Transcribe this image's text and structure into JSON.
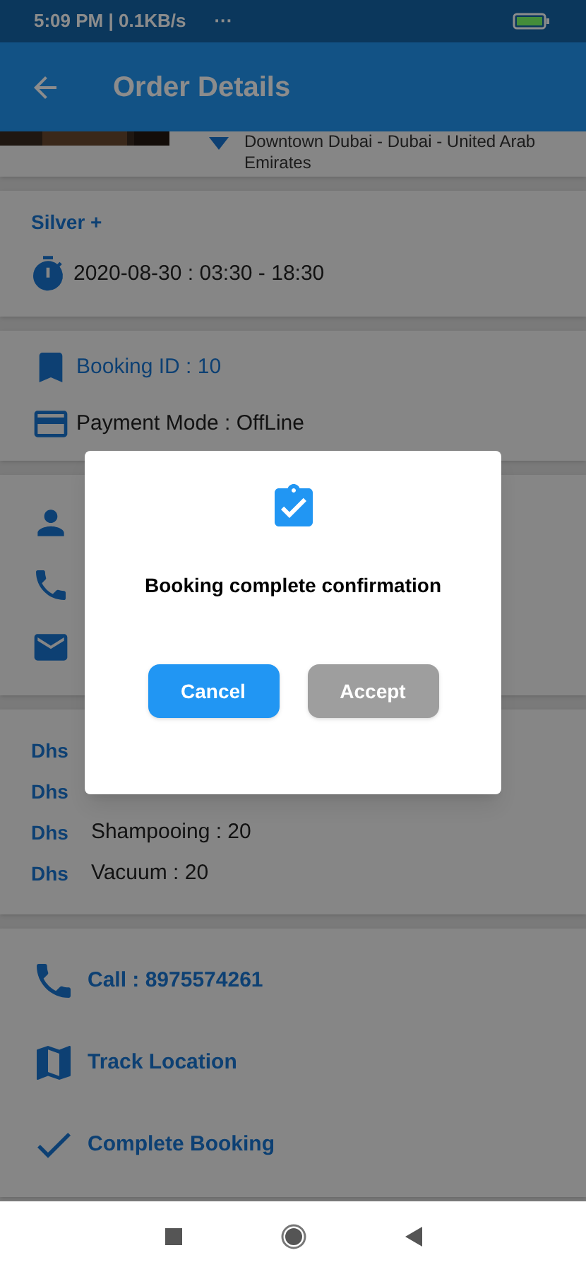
{
  "status_bar": {
    "time": "5:09 PM | 0.1KB/s",
    "more": "···"
  },
  "app_bar": {
    "title": "Order Details"
  },
  "location": {
    "address": "Downtown Dubai - Dubai - United Arab Emirates"
  },
  "package": {
    "name": "Silver +",
    "schedule": "2020-08-30 : 03:30 - 18:30"
  },
  "booking": {
    "id": "Booking ID : 10",
    "payment": "Payment Mode : OffLine"
  },
  "services": [
    {
      "currency": "Dhs"
    },
    {
      "currency": "Dhs"
    },
    {
      "currency": "Dhs",
      "text": "Shampooing : 20"
    },
    {
      "currency": "Dhs",
      "text": "Vacuum : 20"
    }
  ],
  "actions": [
    {
      "kind": "call",
      "label": "Call : 8975574261"
    },
    {
      "kind": "map",
      "label": "Track Location"
    },
    {
      "kind": "check",
      "label": "Complete Booking"
    }
  ],
  "dialog": {
    "message": "Booking complete confirmation",
    "buttons": [
      {
        "label": "Cancel",
        "kind": "primary"
      },
      {
        "label": "Accept",
        "kind": "secondary"
      }
    ]
  }
}
